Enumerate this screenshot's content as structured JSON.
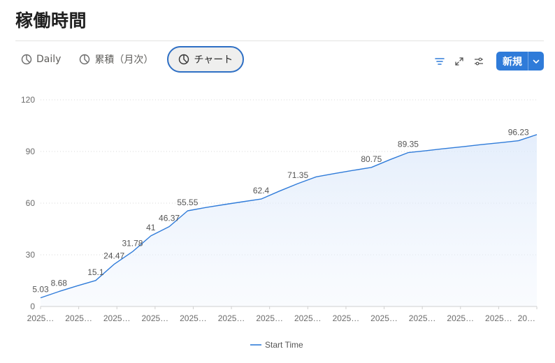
{
  "page": {
    "title": "稼働時間"
  },
  "tabs": [
    {
      "label": "Daily",
      "icon": "pie-chart-icon",
      "active": false
    },
    {
      "label": "累積（月次）",
      "icon": "pie-chart-icon",
      "active": false
    },
    {
      "label": "チャート",
      "icon": "pie-chart-icon",
      "active": true
    }
  ],
  "toolbar": {
    "icons": [
      "filter-icon",
      "expand-icon",
      "settings-sliders-icon"
    ],
    "new_label": "新規",
    "accent": "#2f7bd9"
  },
  "chart_data": {
    "type": "area",
    "x_tick_labels": [
      "2025…",
      "2025…",
      "2025…",
      "2025…",
      "2025…",
      "2025…",
      "2025…",
      "2025…",
      "2025…",
      "2025…",
      "2025…",
      "2025…",
      "2025…",
      "20…"
    ],
    "y_ticks": [
      0,
      30,
      60,
      90,
      120
    ],
    "ylim": [
      0,
      120
    ],
    "grid": true,
    "legend_position": "bottom",
    "line_color": "#2f7bd9",
    "series": [
      {
        "name": "Start Time",
        "points": [
          {
            "x": 0,
            "y": 5.03,
            "label": "5.03"
          },
          {
            "x": 1,
            "y": 8.68,
            "label": "8.68"
          },
          {
            "x": 2,
            "y": 12.0,
            "label": null
          },
          {
            "x": 3,
            "y": 15.1,
            "label": "15.1"
          },
          {
            "x": 4,
            "y": 24.47,
            "label": "24.47"
          },
          {
            "x": 5,
            "y": 31.78,
            "label": "31.78"
          },
          {
            "x": 6,
            "y": 41,
            "label": "41"
          },
          {
            "x": 7,
            "y": 46.37,
            "label": "46.37"
          },
          {
            "x": 8,
            "y": 55.55,
            "label": "55.55"
          },
          {
            "x": 9,
            "y": 57.5,
            "label": null
          },
          {
            "x": 10,
            "y": 59.2,
            "label": null
          },
          {
            "x": 11,
            "y": 60.8,
            "label": null
          },
          {
            "x": 12,
            "y": 62.4,
            "label": "62.4"
          },
          {
            "x": 13,
            "y": 67.0,
            "label": null
          },
          {
            "x": 14,
            "y": 71.35,
            "label": "71.35"
          },
          {
            "x": 15,
            "y": 75.3,
            "label": null
          },
          {
            "x": 16,
            "y": 77.2,
            "label": null
          },
          {
            "x": 17,
            "y": 79.0,
            "label": null
          },
          {
            "x": 18,
            "y": 80.75,
            "label": "80.75"
          },
          {
            "x": 19,
            "y": 85.2,
            "label": null
          },
          {
            "x": 20,
            "y": 89.35,
            "label": "89.35"
          },
          {
            "x": 21,
            "y": 90.5,
            "label": null
          },
          {
            "x": 22,
            "y": 91.7,
            "label": null
          },
          {
            "x": 23,
            "y": 92.8,
            "label": null
          },
          {
            "x": 24,
            "y": 94.0,
            "label": null
          },
          {
            "x": 25,
            "y": 95.1,
            "label": null
          },
          {
            "x": 26,
            "y": 96.23,
            "label": "96.23"
          },
          {
            "x": 27,
            "y": 99.8,
            "label": null
          }
        ]
      }
    ]
  }
}
